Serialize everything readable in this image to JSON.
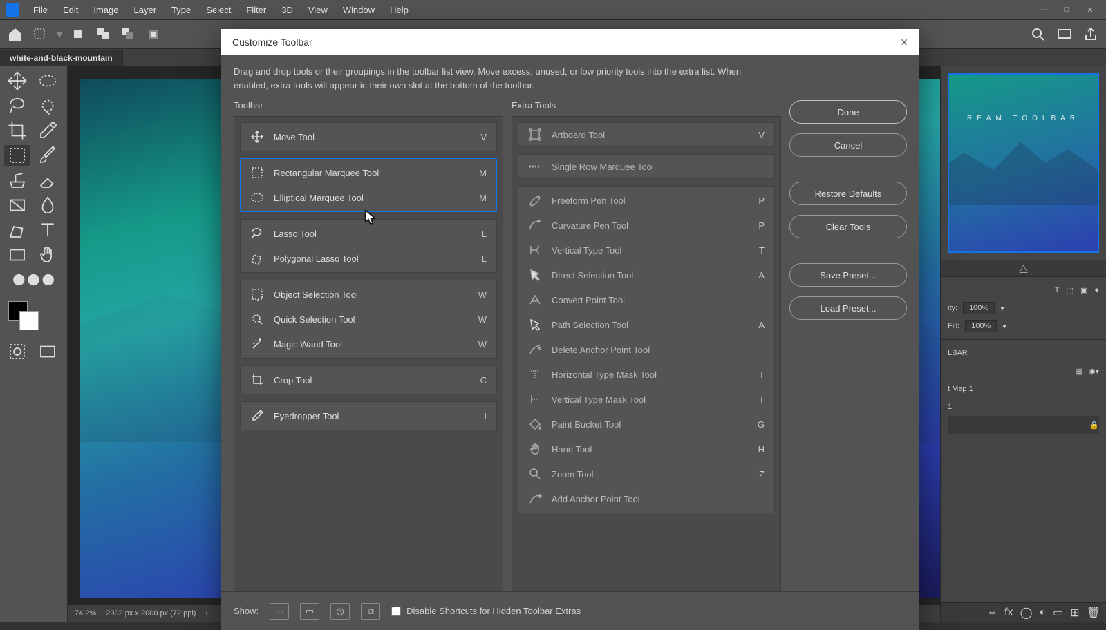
{
  "menubar": [
    "File",
    "Edit",
    "Image",
    "Layer",
    "Type",
    "Select",
    "Filter",
    "3D",
    "View",
    "Window",
    "Help"
  ],
  "doc_tab": "white-and-black-mountain",
  "dialog": {
    "title": "Customize Toolbar",
    "description": "Drag and drop tools or their groupings in the toolbar list view. Move excess, unused, or low priority tools into the extra list. When enabled, extra tools will appear in their own slot at the bottom of the toolbar.",
    "toolbar_heading": "Toolbar",
    "extra_heading": "Extra Tools",
    "buttons": {
      "done": "Done",
      "cancel": "Cancel",
      "restore": "Restore Defaults",
      "clear": "Clear Tools",
      "save": "Save Preset...",
      "load": "Load Preset..."
    },
    "footer": {
      "show_label": "Show:",
      "checkbox_label": "Disable Shortcuts for Hidden Toolbar Extras"
    },
    "toolbar_groups": [
      {
        "items": [
          {
            "name": "Move Tool",
            "key": "V",
            "icon": "move"
          }
        ]
      },
      {
        "selected": true,
        "items": [
          {
            "name": "Rectangular Marquee Tool",
            "key": "M",
            "icon": "rect-marquee"
          },
          {
            "name": "Elliptical Marquee Tool",
            "key": "M",
            "icon": "ellip-marquee"
          }
        ]
      },
      {
        "items": [
          {
            "name": "Lasso Tool",
            "key": "L",
            "icon": "lasso"
          },
          {
            "name": "Polygonal Lasso Tool",
            "key": "L",
            "icon": "poly-lasso"
          }
        ]
      },
      {
        "items": [
          {
            "name": "Object Selection Tool",
            "key": "W",
            "icon": "obj-sel"
          },
          {
            "name": "Quick Selection Tool",
            "key": "W",
            "icon": "quick-sel"
          },
          {
            "name": "Magic Wand Tool",
            "key": "W",
            "icon": "wand"
          }
        ]
      },
      {
        "items": [
          {
            "name": "Crop Tool",
            "key": "C",
            "icon": "crop"
          }
        ]
      },
      {
        "items": [
          {
            "name": "Eyedropper Tool",
            "key": "I",
            "icon": "eyedrop"
          }
        ]
      }
    ],
    "extra_groups": [
      [
        {
          "name": "Artboard Tool",
          "key": "V",
          "icon": "artboard"
        }
      ],
      [
        {
          "name": "Single Row Marquee Tool",
          "key": "",
          "icon": "row-marquee"
        }
      ],
      [
        {
          "name": "Freeform Pen Tool",
          "key": "P",
          "icon": "freepen"
        },
        {
          "name": "Curvature Pen Tool",
          "key": "P",
          "icon": "curvpen"
        },
        {
          "name": "Vertical Type Tool",
          "key": "T",
          "icon": "vtype"
        },
        {
          "name": "Direct Selection Tool",
          "key": "A",
          "icon": "direct"
        },
        {
          "name": "Convert Point Tool",
          "key": "",
          "icon": "convert"
        },
        {
          "name": "Path Selection Tool",
          "key": "A",
          "icon": "pathsel"
        },
        {
          "name": "Delete Anchor Point Tool",
          "key": "",
          "icon": "delanchor"
        },
        {
          "name": "Horizontal Type Mask Tool",
          "key": "T",
          "icon": "htypemask"
        },
        {
          "name": "Vertical Type Mask Tool",
          "key": "T",
          "icon": "vtypemask"
        },
        {
          "name": "Paint Bucket Tool",
          "key": "G",
          "icon": "bucket"
        },
        {
          "name": "Hand Tool",
          "key": "H",
          "icon": "hand"
        },
        {
          "name": "Zoom Tool",
          "key": "Z",
          "icon": "zoom"
        },
        {
          "name": "Add Anchor Point Tool",
          "key": "",
          "icon": "addanchor"
        }
      ]
    ]
  },
  "right_panels": {
    "preview_text": "REAM TOOLBAR",
    "opacity_label": "ity:",
    "opacity_value": "100%",
    "fill_label": "Fill:",
    "fill_value": "100%",
    "layer1": "LBAR",
    "layer2": "t Map 1",
    "layer3": "1"
  },
  "status": {
    "zoom": "74.2%",
    "dims": "2992 px x 2000 px (72 ppi)"
  }
}
